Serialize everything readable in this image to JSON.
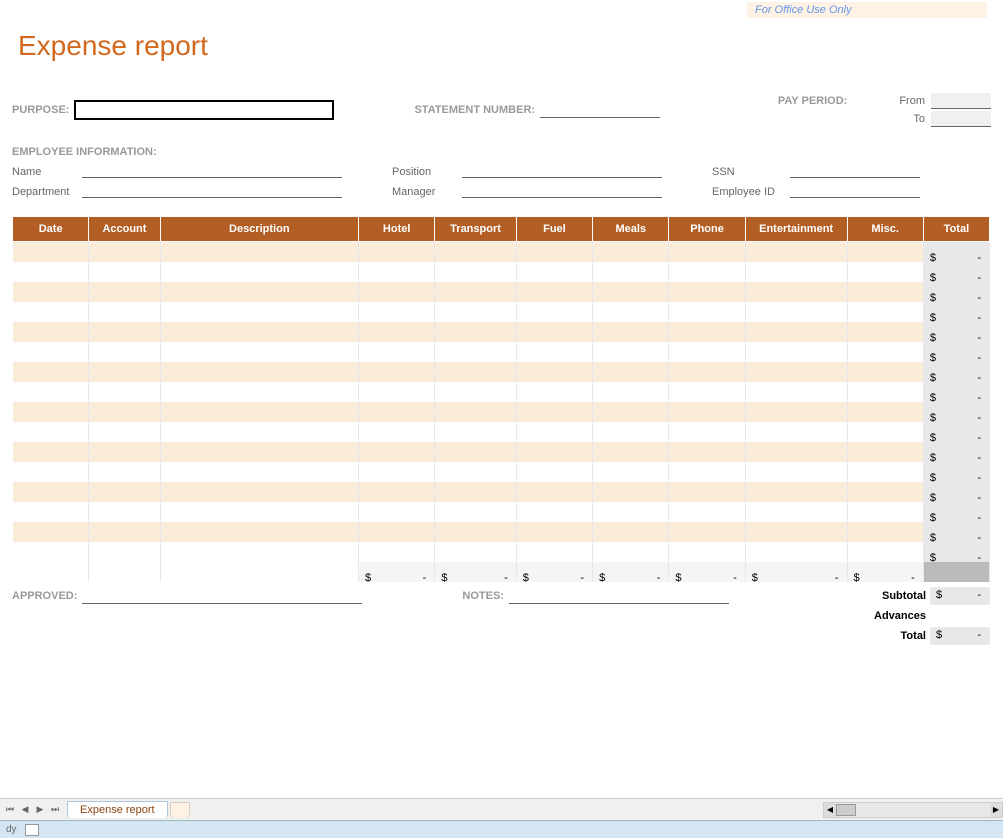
{
  "office_use": "For Office Use Only",
  "title": "Expense report",
  "labels": {
    "purpose": "PURPOSE:",
    "statement_number": "STATEMENT NUMBER:",
    "pay_period": "PAY PERIOD:",
    "from": "From",
    "to": "To",
    "employee_info": "EMPLOYEE INFORMATION:",
    "name": "Name",
    "position": "Position",
    "ssn": "SSN",
    "department": "Department",
    "manager": "Manager",
    "employee_id": "Employee ID",
    "approved": "APPROVED:",
    "notes": "NOTES:"
  },
  "table": {
    "headers": [
      "Date",
      "Account",
      "Description",
      "Hotel",
      "Transport",
      "Fuel",
      "Meals",
      "Phone",
      "Entertainment",
      "Misc.",
      "Total"
    ],
    "row_count": 16,
    "row_total_display": {
      "currency": "$",
      "dash": "-"
    },
    "footer_totals": [
      {
        "currency": "$",
        "dash": "-"
      },
      {
        "currency": "$",
        "dash": "-"
      },
      {
        "currency": "$",
        "dash": "-"
      },
      {
        "currency": "$",
        "dash": "-"
      },
      {
        "currency": "$",
        "dash": "-"
      },
      {
        "currency": "$",
        "dash": "-"
      },
      {
        "currency": "$",
        "dash": "-"
      }
    ]
  },
  "summary": {
    "subtotal": {
      "label": "Subtotal",
      "currency": "$",
      "dash": "-"
    },
    "advances": {
      "label": "Advances"
    },
    "total": {
      "label": "Total",
      "currency": "$",
      "dash": "-"
    }
  },
  "tabs": {
    "sheet": "Expense report"
  },
  "status": {
    "ready": "dy"
  }
}
